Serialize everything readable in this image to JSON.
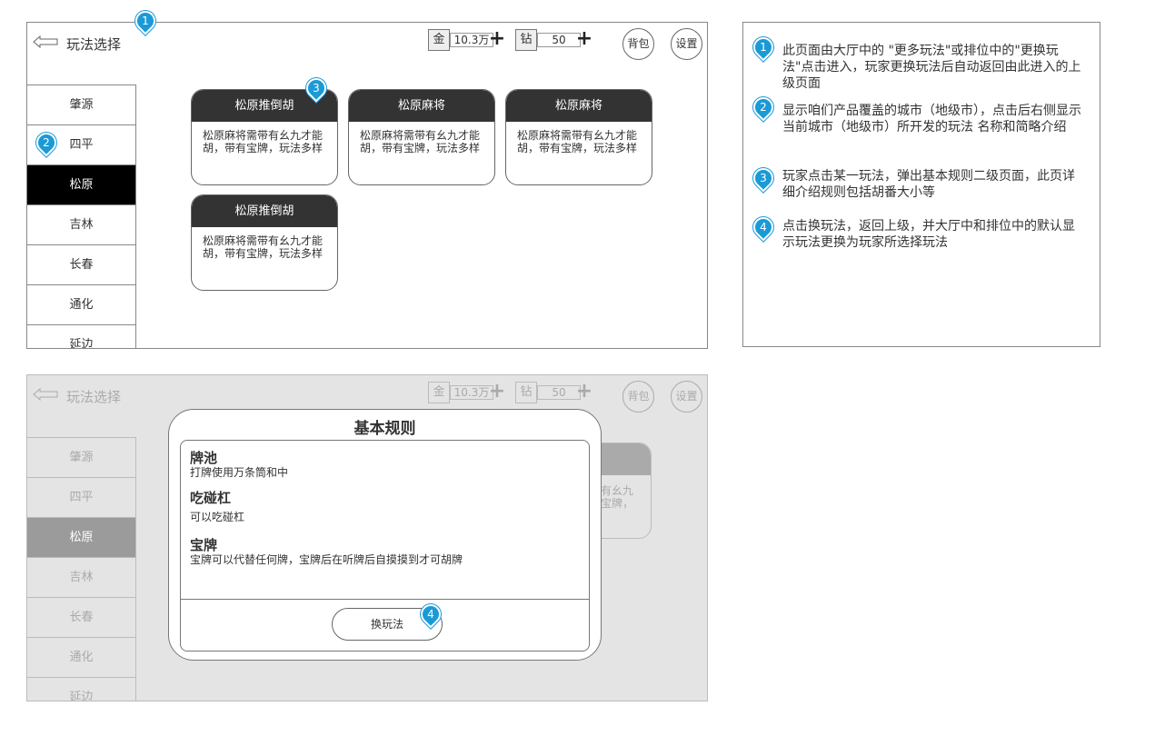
{
  "colors": {
    "accent": "#1a9ad6",
    "selected": "#000000",
    "card_header": "#333333",
    "overlay": "#e4e4e4"
  },
  "screen1": {
    "title": "玩法选择",
    "gold": {
      "icon": "金",
      "value": "10.3万",
      "plus": "+"
    },
    "diamond": {
      "icon": "钻",
      "value": "50",
      "plus": "+"
    },
    "bag_label": "背包",
    "settings_label": "设置",
    "cities": [
      "肇源",
      "四平",
      "松原",
      "吉林",
      "长春",
      "通化",
      "延边"
    ],
    "selected_city": "松原",
    "cards": [
      {
        "name": "松原推倒胡",
        "desc": "松原麻将需带有幺九才能胡，带有宝牌，玩法多样"
      },
      {
        "name": "松原麻将",
        "desc": "松原麻将需带有幺九才能胡，带有宝牌，玩法多样"
      },
      {
        "name": "松原麻将",
        "desc": "松原麻将需带有幺九才能胡，带有宝牌，玩法多样"
      },
      {
        "name": "松原推倒胡",
        "desc": "松原麻将需带有幺九才能胡，带有宝牌，玩法多样"
      }
    ]
  },
  "screen2": {
    "title": "玩法选择",
    "gold": {
      "icon": "金",
      "value": "10.3万",
      "plus": "+"
    },
    "diamond": {
      "icon": "钻",
      "value": "50",
      "plus": "+"
    },
    "bag_label": "背包",
    "settings_label": "设置",
    "cities": [
      "肇源",
      "四平",
      "松原",
      "吉林",
      "长春",
      "通化",
      "延边"
    ],
    "ghost_card_text": [
      "有幺九",
      "宝牌，"
    ],
    "modal": {
      "title": "基本规则",
      "rules": [
        {
          "heading": "牌池",
          "text": "打牌使用万条筒和中"
        },
        {
          "heading": "吃碰杠",
          "text": "可以吃碰杠"
        },
        {
          "heading": "宝牌",
          "text": "宝牌可以代替任何牌，宝牌后在听牌后自摸摸到才可胡牌"
        }
      ],
      "button_label": "换玩法"
    }
  },
  "pins": [
    "1",
    "2",
    "3",
    "4"
  ],
  "notes": [
    {
      "num": "1",
      "text": "此页面由大厅中的 \"更多玩法\"或排位中的\"更换玩法\"点击进入，玩家更换玩法后自动返回由此进入的上级页面"
    },
    {
      "num": "2",
      "text": "显示咱们产品覆盖的城市（地级市），点击后右侧显示当前城市（地级市）所开发的玩法 名称和简略介绍"
    },
    {
      "num": "3",
      "text": "玩家点击某一玩法，弹出基本规则二级页面，此页详细介绍规则包括胡番大小等"
    },
    {
      "num": "4",
      "text": "点击换玩法，返回上级，并大厅中和排位中的默认显示玩法更换为玩家所选择玩法"
    }
  ]
}
